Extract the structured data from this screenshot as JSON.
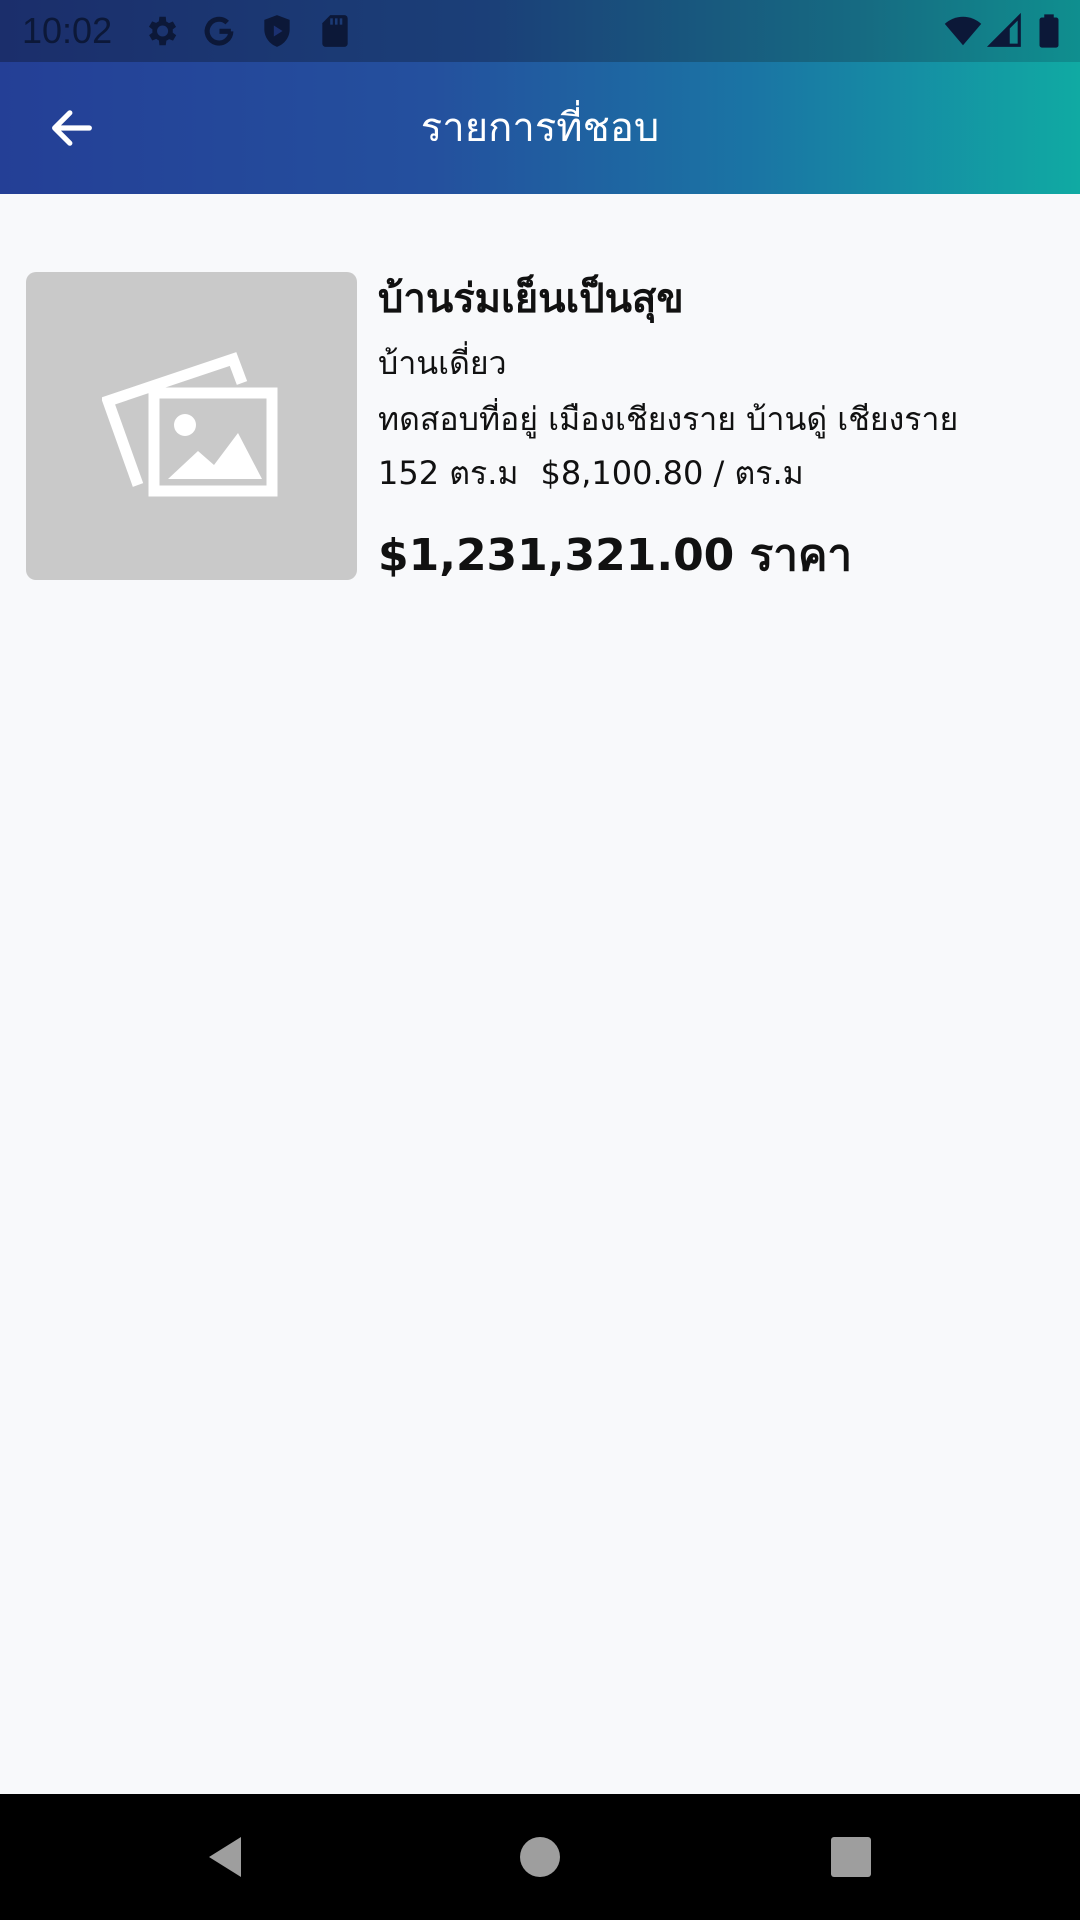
{
  "status_bar": {
    "time": "10:02",
    "left_icons": [
      "settings-icon",
      "google-icon",
      "play-protect-icon",
      "sd-card-icon"
    ],
    "right_icons": [
      "wifi-icon",
      "signal-icon",
      "battery-icon"
    ]
  },
  "app_bar": {
    "title": "รายการที่ชอบ",
    "back_icon": "arrow-back-icon"
  },
  "favorites": [
    {
      "name": "บ้านร่มเย็นเป็นสุข",
      "type": "บ้านเดี่ยว",
      "address": "ทดสอบที่อยู่ เมืองเชียงราย บ้านดู่ เชียงราย",
      "area": "152 ตร.ม",
      "price_per_sqm": "$8,100.80 / ตร.ม",
      "price": "$1,231,321.00 ราคา",
      "image": "image-placeholder-icon"
    }
  ],
  "nav_bar": {
    "buttons": [
      "back-triangle-icon",
      "home-circle-icon",
      "recents-square-icon"
    ]
  },
  "colors": {
    "app_bar_start": "#243f96",
    "app_bar_end": "#10aaa3",
    "background": "#f8f9fb",
    "placeholder": "#c9c9c9"
  }
}
